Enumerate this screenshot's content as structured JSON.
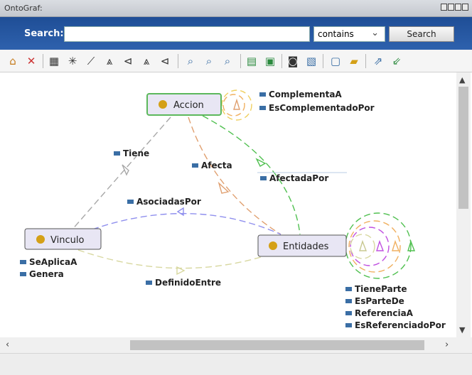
{
  "window": {
    "title": "OntoGraf:"
  },
  "search": {
    "label": "Search:",
    "value": "",
    "mode": "contains",
    "button": "Search"
  },
  "toolbar": {
    "icons": [
      "home-icon",
      "remove-icon",
      "grid-layout-icon",
      "radial-layout-icon",
      "spring-layout-icon",
      "tree-down-icon",
      "tree-right-icon",
      "tree-down-alt-icon",
      "tree-left-icon",
      "zoom-in-icon",
      "zoom-out-icon",
      "zoom-fit-icon",
      "filter-nodes-icon",
      "filter-arcs-icon",
      "camera-icon",
      "edit-icon",
      "save-icon",
      "open-icon",
      "export-icon",
      "import-icon"
    ]
  },
  "graph": {
    "nodes": {
      "accion": "Accion",
      "vinculo": "Vinculo",
      "entidades": "Entidades"
    },
    "edges": {
      "complementa": "ComplementaA",
      "escomplementado": "EsComplementadoPor",
      "tiene": "Tiene",
      "afecta": "Afecta",
      "afectada": "AfectadaPor",
      "asociadas": "AsociadasPor",
      "seaplica": "SeAplicaA",
      "genera": "Genera",
      "definido": "DefinidoEntre",
      "tieneparte": "TieneParte",
      "esparte": "EsParteDe",
      "referencia": "ReferenciaA",
      "esreferenciado": "EsReferenciadoPor"
    },
    "colors": {
      "node_dot": "#d4a017",
      "edge_marker": "#3a6ea5",
      "selected_border": "#5cb85c"
    }
  }
}
